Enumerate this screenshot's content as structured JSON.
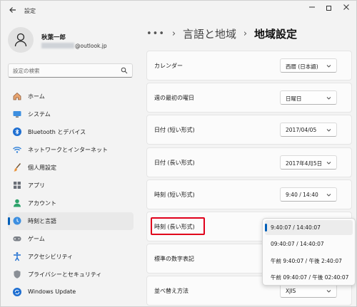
{
  "window": {
    "title": "設定"
  },
  "profile": {
    "name": "秋葉一郎",
    "email_domain": "@outlook.jp"
  },
  "search": {
    "placeholder": "設定の検索"
  },
  "nav": [
    {
      "label": "ホーム",
      "icon": "home-icon"
    },
    {
      "label": "システム",
      "icon": "monitor-icon"
    },
    {
      "label": "Bluetooth とデバイス",
      "icon": "bluetooth-icon"
    },
    {
      "label": "ネットワークとインターネット",
      "icon": "wifi-icon"
    },
    {
      "label": "個人用設定",
      "icon": "brush-icon"
    },
    {
      "label": "アプリ",
      "icon": "apps-icon"
    },
    {
      "label": "アカウント",
      "icon": "account-icon"
    },
    {
      "label": "時刻と言語",
      "icon": "clock-globe-icon",
      "active": true
    },
    {
      "label": "ゲーム",
      "icon": "gamepad-icon"
    },
    {
      "label": "アクセシビリティ",
      "icon": "accessibility-icon"
    },
    {
      "label": "プライバシーとセキュリティ",
      "icon": "shield-icon"
    },
    {
      "label": "Windows Update",
      "icon": "update-icon"
    }
  ],
  "breadcrumb": {
    "more": "•••",
    "parent": "言語と地域",
    "current": "地域設定"
  },
  "settings": [
    {
      "label": "カレンダー",
      "value": "西暦 (日本語)"
    },
    {
      "label": "週の最初の曜日",
      "value": "日曜日"
    },
    {
      "label": "日付 (短い形式)",
      "value": "2017/04/05"
    },
    {
      "label": "日付 (長い形式)",
      "value": "2017年4月5日"
    },
    {
      "label": "時刻 (短い形式)",
      "value": "9:40 / 14:40"
    },
    {
      "label": "時刻 (長い形式)",
      "value": ""
    },
    {
      "label": "標準の数字表記",
      "value": ""
    },
    {
      "label": "並べ替え方法",
      "value": "XJIS"
    }
  ],
  "dropdown_options": [
    {
      "label": "9:40:07 / 14:40:07",
      "selected": true
    },
    {
      "label": "09:40:07 / 14:40:07"
    },
    {
      "label": "午前 9:40:07 / 午後 2:40:07"
    },
    {
      "label": "午前 09:40:07 / 午後 02:40:07"
    }
  ],
  "colors": {
    "accent": "#005fb8",
    "highlight": "#e0001b"
  }
}
